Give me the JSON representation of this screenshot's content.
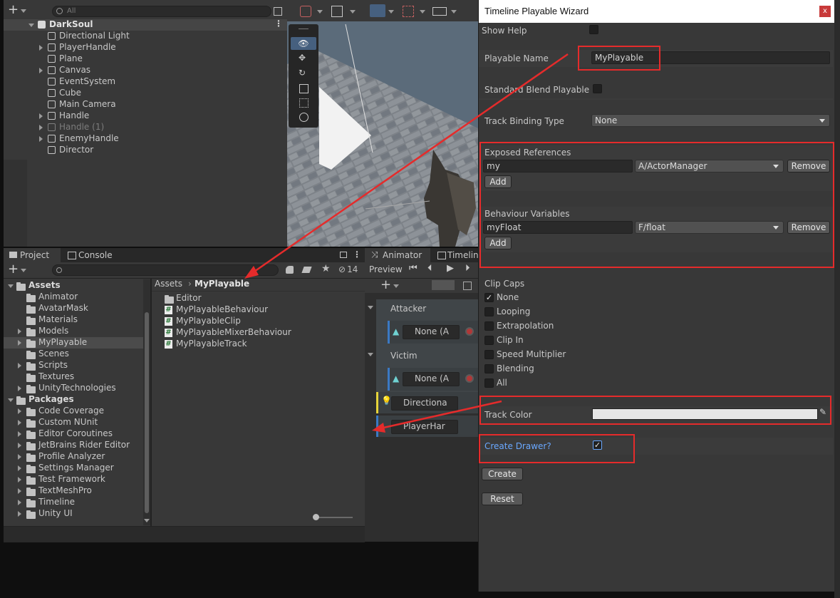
{
  "hierarchy": {
    "search_placeholder": "All",
    "root": "DarkSoul",
    "items": [
      {
        "label": "Directional Light",
        "expandable": false,
        "dim": false
      },
      {
        "label": "PlayerHandle",
        "expandable": true,
        "dim": false
      },
      {
        "label": "Plane",
        "expandable": false,
        "dim": false
      },
      {
        "label": "Canvas",
        "expandable": true,
        "dim": false
      },
      {
        "label": "EventSystem",
        "expandable": false,
        "dim": false
      },
      {
        "label": "Cube",
        "expandable": false,
        "dim": false
      },
      {
        "label": "Main Camera",
        "expandable": false,
        "dim": false
      },
      {
        "label": "Handle",
        "expandable": true,
        "dim": false
      },
      {
        "label": "Handle (1)",
        "expandable": true,
        "dim": true
      },
      {
        "label": "EnemyHandle",
        "expandable": true,
        "dim": false
      },
      {
        "label": "Director",
        "expandable": false,
        "dim": false
      }
    ]
  },
  "project": {
    "tab_project": "Project",
    "tab_console": "Console",
    "hidden_count": "14",
    "tree": [
      {
        "label": "Assets",
        "level": 0,
        "expanded": true,
        "selected": false
      },
      {
        "label": "Animator",
        "level": 1,
        "expandable": false
      },
      {
        "label": "AvatarMask",
        "level": 1,
        "expandable": false
      },
      {
        "label": "Materials",
        "level": 1,
        "expandable": false
      },
      {
        "label": "Models",
        "level": 1,
        "expandable": true
      },
      {
        "label": "MyPlayable",
        "level": 1,
        "expandable": true,
        "selected": true
      },
      {
        "label": "Scenes",
        "level": 1,
        "expandable": false
      },
      {
        "label": "Scripts",
        "level": 1,
        "expandable": true
      },
      {
        "label": "Textures",
        "level": 1,
        "expandable": false
      },
      {
        "label": "UnityTechnologies",
        "level": 1,
        "expandable": true
      },
      {
        "label": "Packages",
        "level": 0,
        "expanded": true
      },
      {
        "label": "Code Coverage",
        "level": 1,
        "expandable": true
      },
      {
        "label": "Custom NUnit",
        "level": 1,
        "expandable": true
      },
      {
        "label": "Editor Coroutines",
        "level": 1,
        "expandable": true
      },
      {
        "label": "JetBrains Rider Editor",
        "level": 1,
        "expandable": true
      },
      {
        "label": "Profile Analyzer",
        "level": 1,
        "expandable": true
      },
      {
        "label": "Settings Manager",
        "level": 1,
        "expandable": true
      },
      {
        "label": "Test Framework",
        "level": 1,
        "expandable": true
      },
      {
        "label": "TextMeshPro",
        "level": 1,
        "expandable": true
      },
      {
        "label": "Timeline",
        "level": 1,
        "expandable": true
      },
      {
        "label": "Unity UI",
        "level": 1,
        "expandable": true
      }
    ],
    "breadcrumb_root": "Assets",
    "breadcrumb_current": "MyPlayable",
    "files": [
      {
        "label": "Editor",
        "type": "folder"
      },
      {
        "label": "MyPlayableBehaviour",
        "type": "script"
      },
      {
        "label": "MyPlayableClip",
        "type": "script"
      },
      {
        "label": "MyPlayableMixerBehaviour",
        "type": "script"
      },
      {
        "label": "MyPlayableTrack",
        "type": "script"
      }
    ]
  },
  "timeline": {
    "tab_animator": "Animator",
    "tab_timeline": "Timelin",
    "preview_label": "Preview",
    "groups": [
      "Attacker",
      "Victim"
    ],
    "track_none_1": "None (A",
    "track_none_2": "None (A",
    "track_directional": "Directiona",
    "track_player": "PlayerHar"
  },
  "wizard": {
    "title": "Timeline Playable Wizard",
    "close_glyph": "x",
    "show_help_label": "Show Help",
    "playable_name_label": "Playable Name",
    "playable_name_value": "MyPlayable",
    "standard_blend_label": "Standard Blend Playable",
    "track_binding_label": "Track Binding Type",
    "track_binding_value": "None",
    "exposed_refs_label": "Exposed References",
    "exposed_ref_name": "my",
    "exposed_ref_type": "A/ActorManager",
    "remove_label": "Remove",
    "add_label": "Add",
    "behaviour_vars_label": "Behaviour Variables",
    "behaviour_var_name": "myFloat",
    "behaviour_var_type": "F/float",
    "clip_caps_label": "Clip Caps",
    "clip_caps": [
      {
        "label": "None",
        "checked": true
      },
      {
        "label": "Looping",
        "checked": false
      },
      {
        "label": "Extrapolation",
        "checked": false
      },
      {
        "label": "Clip In",
        "checked": false
      },
      {
        "label": "Speed Multiplier",
        "checked": false
      },
      {
        "label": "Blending",
        "checked": false
      },
      {
        "label": "All",
        "checked": false
      }
    ],
    "track_color_label": "Track Color",
    "track_color_value": "#e6e6e6",
    "create_drawer_label": "Create Drawer?",
    "create_drawer_checked": true,
    "create_button": "Create",
    "reset_button": "Reset"
  },
  "colors": {
    "annotation_red": "#e52b2b",
    "link_blue": "#6aa8ff",
    "selection": "#4b4b4b"
  }
}
